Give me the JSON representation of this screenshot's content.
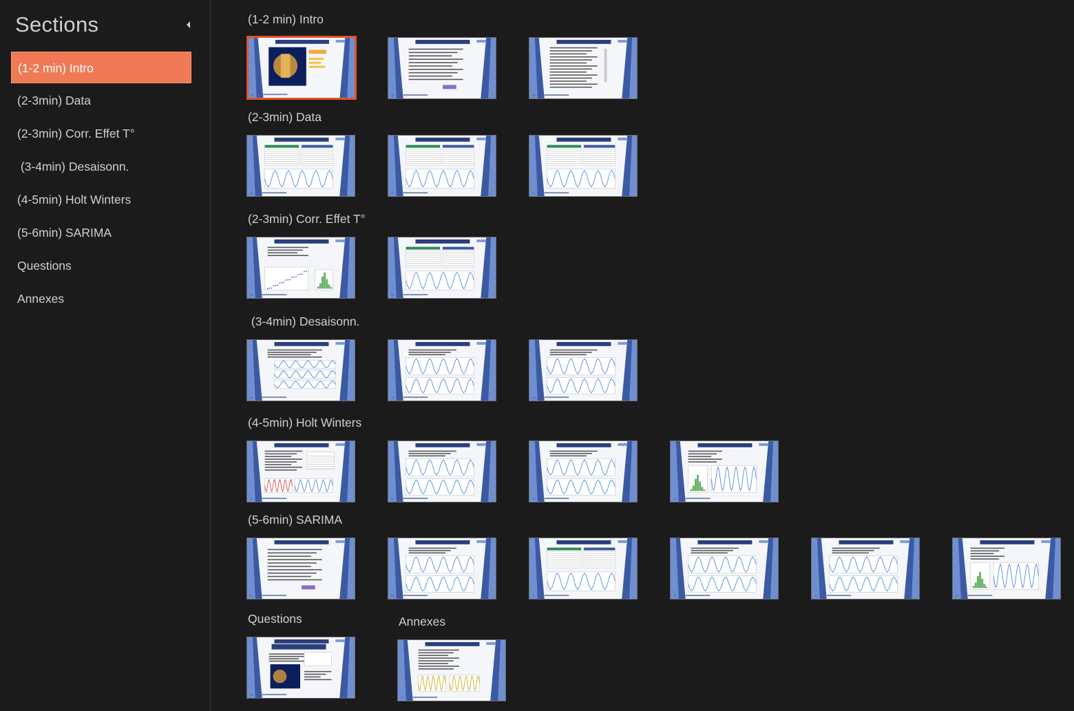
{
  "sidebar": {
    "title": "Sections",
    "collapse_icon": "chevron-left-icon",
    "items": [
      {
        "label": "(1-2 min) Intro",
        "active": true
      },
      {
        "label": "(2-3min) Data"
      },
      {
        "label": "(2-3min) Corr. Effet T°"
      },
      {
        "label": " (3-4min) Desaisonn."
      },
      {
        "label": "(4-5min) Holt Winters"
      },
      {
        "label": "(5-6min) SARIMA"
      },
      {
        "label": "Questions"
      },
      {
        "label": "Annexes"
      }
    ]
  },
  "sections": [
    {
      "header": "(1-2 min) Intro",
      "slides": [
        {
          "kind": "cover",
          "selected": true
        },
        {
          "kind": "text"
        },
        {
          "kind": "toc"
        }
      ]
    },
    {
      "header": "(2-3min) Data",
      "slides": [
        {
          "kind": "table-chart"
        },
        {
          "kind": "table-chart"
        },
        {
          "kind": "table-chart"
        }
      ]
    },
    {
      "header": "(2-3min) Corr. Effet T°",
      "slides": [
        {
          "kind": "scatter"
        },
        {
          "kind": "table-chart"
        }
      ]
    },
    {
      "header": " (3-4min) Desaisonn.",
      "slides": [
        {
          "kind": "multi-chart"
        },
        {
          "kind": "chart"
        },
        {
          "kind": "chart"
        }
      ]
    },
    {
      "header": "(4-5min) Holt Winters",
      "slides": [
        {
          "kind": "text-chart"
        },
        {
          "kind": "chart"
        },
        {
          "kind": "chart"
        },
        {
          "kind": "hist"
        }
      ]
    },
    {
      "header": "(5-6min) SARIMA",
      "slides": [
        {
          "kind": "text"
        },
        {
          "kind": "chart"
        },
        {
          "kind": "table-chart"
        },
        {
          "kind": "chart"
        },
        {
          "kind": "chart"
        },
        {
          "kind": "hist"
        }
      ]
    },
    {
      "header": "Questions",
      "slides": [
        {
          "kind": "questions"
        }
      ]
    },
    {
      "header": "Annexes",
      "slides": [
        {
          "kind": "annex"
        }
      ]
    }
  ],
  "colors": {
    "accent": "#f07a55",
    "selected_border": "#e0532d",
    "background": "#1b1b1b",
    "slide_blue": "#3b5aa3"
  }
}
